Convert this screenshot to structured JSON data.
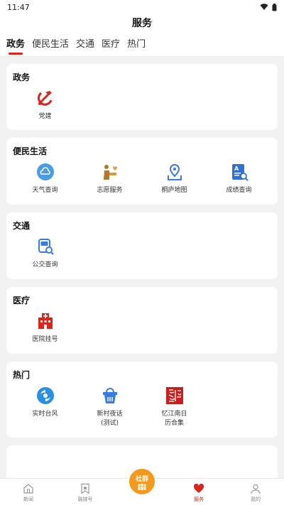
{
  "status": {
    "time": "11:47"
  },
  "header": {
    "title": "服务"
  },
  "tabs": [
    "政务",
    "便民生活",
    "交通",
    "医疗",
    "热门"
  ],
  "sections": {
    "gov": {
      "title": "政务",
      "items": [
        "党建"
      ]
    },
    "life": {
      "title": "便民生活",
      "items": [
        "天气查询",
        "志愿服务",
        "桐庐地图",
        "成绩查询"
      ]
    },
    "traffic": {
      "title": "交通",
      "items": [
        "公交查询"
      ]
    },
    "medical": {
      "title": "医疗",
      "items": [
        "医院挂号"
      ]
    },
    "hot": {
      "title": "热门",
      "items": [
        {
          "line1": "实时台风",
          "line2": ""
        },
        {
          "line1": "新村夜话",
          "line2": "(测试)"
        },
        {
          "line1": "忆江南日",
          "line2": "历合集"
        }
      ]
    }
  },
  "nav": {
    "items": [
      "新闻",
      "融媒号",
      "服务",
      "我的"
    ],
    "center_label": "社群",
    "active": "服务"
  },
  "colors": {
    "accent": "#d8271c",
    "orange": "#f39a1e",
    "blue": "#3a7be0"
  }
}
